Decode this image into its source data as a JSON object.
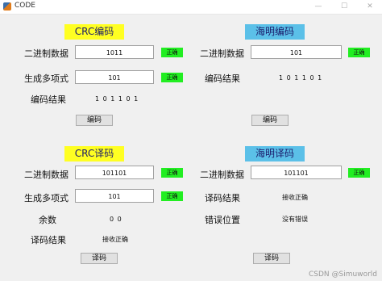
{
  "window": {
    "title": "CODE"
  },
  "crc_encode": {
    "header": "CRC编码",
    "binary_label": "二进制数据",
    "binary_value": "1011",
    "binary_ok": "正确",
    "poly_label": "生成多项式",
    "poly_value": "101",
    "poly_ok": "正确",
    "result_label": "编码结果",
    "result_value": "1 0 1 1 0 1",
    "button": "编码"
  },
  "hamming_encode": {
    "header": "海明编码",
    "binary_label": "二进制数据",
    "binary_value": "101",
    "binary_ok": "正确",
    "result_label": "编码结果",
    "result_value": "1 0 1 1 0 1",
    "button": "编码"
  },
  "crc_decode": {
    "header": "CRC译码",
    "binary_label": "二进制数据",
    "binary_value": "101101",
    "binary_ok": "正确",
    "poly_label": "生成多项式",
    "poly_value": "101",
    "poly_ok": "正确",
    "remainder_label": "余数",
    "remainder_value": "0 0",
    "result_label": "译码结果",
    "result_value": "接收正确",
    "button": "译码"
  },
  "hamming_decode": {
    "header": "海明译码",
    "binary_label": "二进制数据",
    "binary_value": "101101",
    "binary_ok": "正确",
    "result_label": "译码结果",
    "result_value": "接收正确",
    "error_label": "错误位置",
    "error_value": "没有错误",
    "button": "译码"
  },
  "watermark": "CSDN @Simuworld",
  "colors": {
    "crc_header": "#ffff22",
    "hamming_header": "#5bc0e8",
    "ok_badge": "#22ee22"
  }
}
